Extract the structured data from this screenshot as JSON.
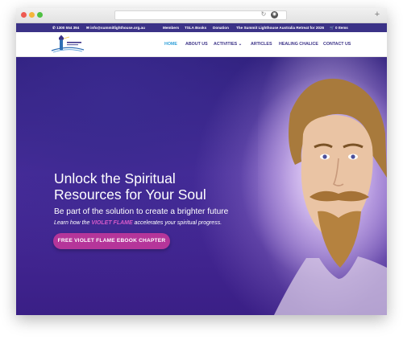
{
  "browser": {
    "reload_glyph": "↻",
    "extension_glyph": "◉",
    "newtab_glyph": "+"
  },
  "topbar": {
    "phone": "1300 554 394",
    "email": "info@summitlighthouse.org.au",
    "links": [
      "Members",
      "TSLA Books",
      "Donation",
      "The Summit Lighthouse Australia Retreat for 2026"
    ],
    "cart": "0 Items",
    "phone_icon": "phone-icon",
    "email_icon": "envelope-icon",
    "cart_icon": "cart-icon",
    "bg_color": "#3b3287"
  },
  "nav": {
    "items": [
      "HOME",
      "ABOUT US",
      "ACTIVITIES",
      "ARTICLES",
      "HEALING CHALICE",
      "CONTACT US"
    ],
    "active": "HOME",
    "dropdown_glyph": "⌄",
    "active_color": "#2f9fd8",
    "text_color": "#3b3287"
  },
  "hero": {
    "title_line1": "Unlock the Spiritual",
    "title_line2": "Resources for Your Soul",
    "subtitle": "Be part of the solution to create a brighter future",
    "lead_before": "Learn how the ",
    "lead_highlight": "VIOLET FLAME",
    "lead_after": " accelerates your spiritual progress.",
    "cta_label": "FREE VIOLET FLAME EBOOK CHAPTER",
    "highlight_color": "#d65ac9",
    "cta_color": "#b5359a"
  }
}
